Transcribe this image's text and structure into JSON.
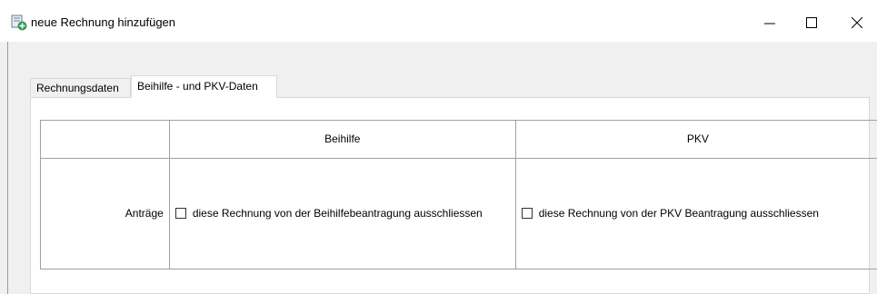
{
  "window": {
    "title": "neue Rechnung hinzufügen",
    "icon": "add-document-icon",
    "controls": {
      "minimize": "minimize-icon",
      "maximize": "maximize-icon",
      "close": "close-icon"
    }
  },
  "tabs": [
    {
      "label": "Rechnungsdaten",
      "active": false
    },
    {
      "label": "Beihilfe - und PKV-Daten",
      "active": true
    }
  ],
  "table": {
    "headers": [
      "",
      "Beihilfe",
      "PKV"
    ],
    "row": {
      "label": "Anträge",
      "beihilfe_checkbox": {
        "label": "diese Rechnung von der Beihilfebeantragung ausschliessen",
        "checked": false
      },
      "pkv_checkbox": {
        "label": "diese Rechnung von der PKV Beantragung ausschliessen",
        "checked": false
      }
    }
  },
  "colors": {
    "accent_icon": "#2e9a4f",
    "border": "#a0a0a0",
    "window_bg": "#f0f0f0"
  }
}
